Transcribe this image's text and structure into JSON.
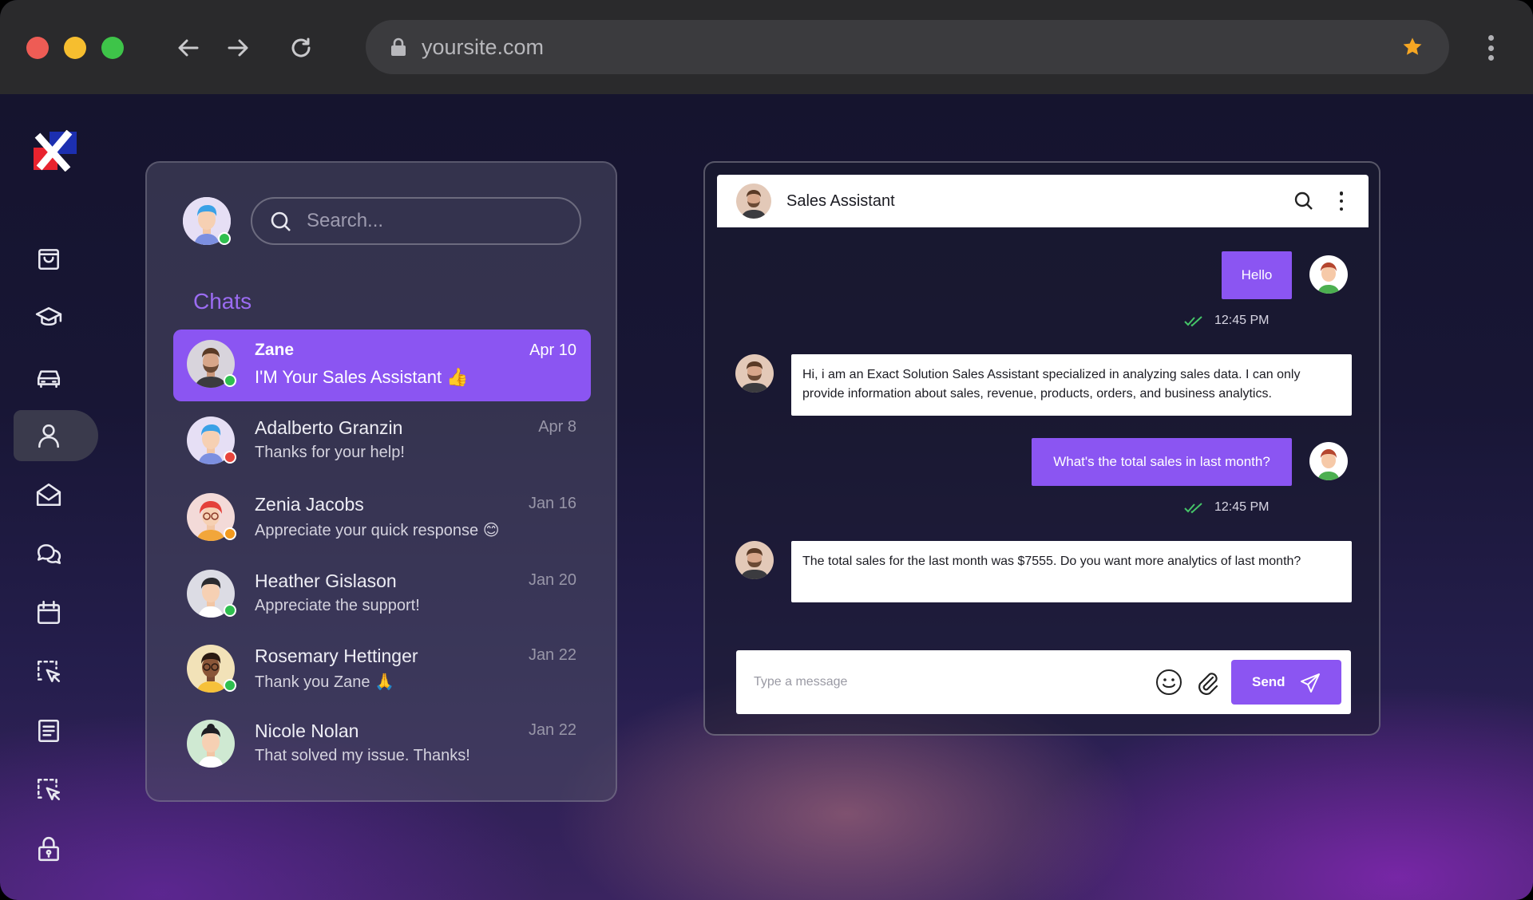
{
  "browser": {
    "url": "yoursite.com"
  },
  "sidebar": {
    "items": [
      {
        "name": "shopping-bag-icon",
        "active": false
      },
      {
        "name": "graduation-cap-icon",
        "active": false
      },
      {
        "name": "car-icon",
        "active": false
      },
      {
        "name": "user-icon",
        "active": true
      },
      {
        "name": "mail-open-icon",
        "active": false
      },
      {
        "name": "chat-bubbles-icon",
        "active": false
      },
      {
        "name": "calendar-icon",
        "active": false
      },
      {
        "name": "select-cursor-icon",
        "active": false
      },
      {
        "name": "document-icon",
        "active": false
      },
      {
        "name": "select-cursor-icon",
        "active": false
      },
      {
        "name": "lock-icon",
        "active": false
      }
    ]
  },
  "chat_list": {
    "search_placeholder": "Search...",
    "title": "Chats",
    "chats": [
      {
        "name": "Zane",
        "message": "I'M Your Sales Assistant 👍",
        "date": "Apr 10",
        "status": "online",
        "active": true
      },
      {
        "name": "Adalberto Granzin",
        "message": "Thanks for your help!",
        "date": "Apr 8",
        "status": "busy",
        "active": false
      },
      {
        "name": "Zenia Jacobs",
        "message": "Appreciate your quick response 😊",
        "date": "Jan 16",
        "status": "away",
        "active": false
      },
      {
        "name": "Heather Gislason",
        "message": "Appreciate the support!",
        "date": "Jan 20",
        "status": "online",
        "active": false
      },
      {
        "name": "Rosemary Hettinger",
        "message": "Thank you Zane  🙏",
        "date": "Jan 22",
        "status": "online",
        "active": false
      },
      {
        "name": "Nicole Nolan",
        "message": "That solved my issue. Thanks!",
        "date": "Jan 22",
        "status": "none",
        "active": false
      }
    ]
  },
  "conversation": {
    "title": "Sales Assistant",
    "messages": [
      {
        "from": "user",
        "text": "Hello",
        "time": "12:45 PM"
      },
      {
        "from": "assistant",
        "text": "Hi, i am an Exact Solution Sales Assistant specialized in analyzing sales data. I can only provide information about sales, revenue, products, orders, and business analytics."
      },
      {
        "from": "user",
        "text": "What's the total sales in last month?",
        "time": "12:45 PM"
      },
      {
        "from": "assistant",
        "text": "The total sales for the last month was $7555. Do you want more analytics of last month?"
      }
    ],
    "composer_placeholder": "Type a message",
    "send_label": "Send"
  },
  "colors": {
    "accent": "#8b55f2",
    "online": "#2fbf4f",
    "busy": "#e8453c",
    "away": "#f39a1e"
  }
}
